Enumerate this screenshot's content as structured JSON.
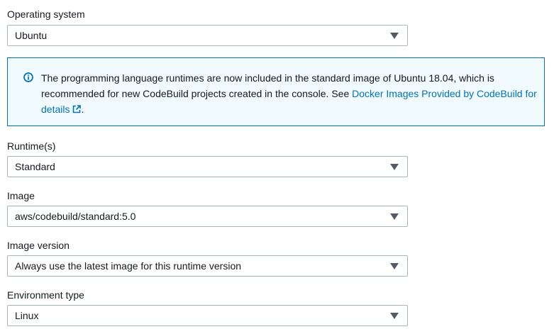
{
  "operating_system": {
    "label": "Operating system",
    "value": "Ubuntu"
  },
  "info": {
    "text_before": "The programming language runtimes are now included in the standard image of Ubuntu 18.04, which is recommended for new CodeBuild projects created in the console. See ",
    "link_text": "Docker Images Provided by CodeBuild for details",
    "text_after": ".",
    "icon": "info-icon",
    "link_icon": "external-link-icon",
    "border_color": "#0073bb",
    "background_color": "#f1faff"
  },
  "runtime": {
    "label": "Runtime(s)",
    "value": "Standard"
  },
  "image": {
    "label": "Image",
    "value": "aws/codebuild/standard:5.0"
  },
  "image_version": {
    "label": "Image version",
    "value": "Always use the latest image for this runtime version"
  },
  "environment_type": {
    "label": "Environment type",
    "value": "Linux"
  }
}
